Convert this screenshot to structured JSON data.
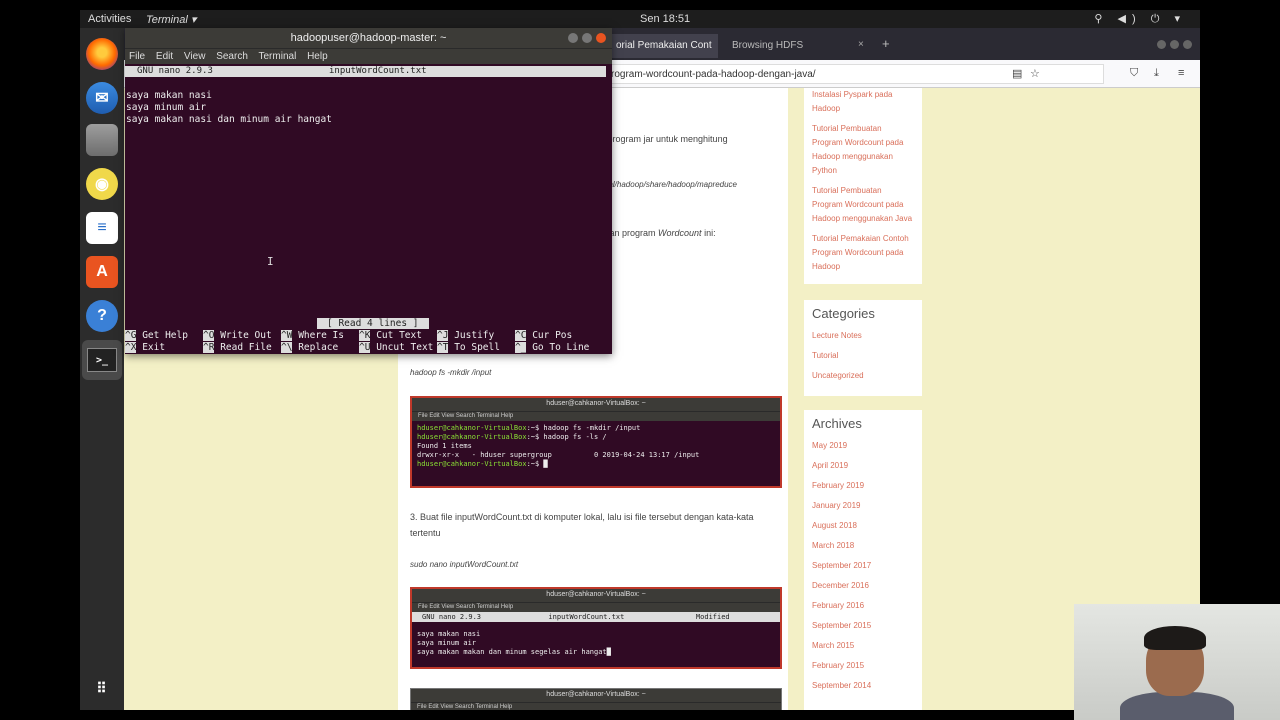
{
  "topbar": {
    "activities": "Activities",
    "app_menu": "Terminal ▾",
    "clock": "Sen 18:51",
    "tray": "⚲ ◀) ⏻ ▾"
  },
  "dock": {
    "items": [
      "firefox-icon",
      "thunderbird-icon",
      "files-icon",
      "rhythmbox-icon",
      "writer-icon",
      "software-icon",
      "help-icon",
      "terminal-icon"
    ],
    "help_glyph": "?",
    "terminal_glyph": ">_"
  },
  "browser": {
    "tab_active": "orial Pemakaian Cont",
    "tab_close": "×",
    "tab2": "Browsing HDFS",
    "new_tab": "+",
    "url": "rogram-wordcount-pada-hadoop-dengan-java/",
    "icons": {
      "reader": "▤",
      "star": "☆",
      "pocket": "⛉",
      "download": "⤓",
      "menu": "≡"
    }
  },
  "content": {
    "line1": "n program jar untuk menghitung",
    "line2": "ocal/hadoop/share/hadoop/mapreduce",
    "line3_prefix": "akan program ",
    "line3_em": "Wordcount",
    "line3_suffix": " ini:",
    "cmd_mkdir": "hadoop fs -mkdir /input",
    "step3": "3. Buat file inputWordCount.txt di komputer lokal, lalu isi file tersebut dengan kata-kata",
    "step3b": "tertentu",
    "cmd_nano": "sudo nano inputWordCount.txt",
    "shot1": {
      "title": "hduser@cahkanor-VirtualBox: ~",
      "menu": "File  Edit  View  Search  Terminal  Help",
      "l1a": "hduser@cahkanor-VirtualBox",
      "l1b": ":~$ hadoop fs -mkdir /input",
      "l2a": "hduser@cahkanor-VirtualBox",
      "l2b": ":~$ hadoop fs -ls /",
      "l3": "Found 1 items",
      "l4": "drwxr-xr-x   - hduser supergroup          0 2019-04-24 13:17 /input",
      "l5a": "hduser@cahkanor-VirtualBox",
      "l5b": ":~$ █"
    },
    "shot2": {
      "title": "hduser@cahkanor-VirtualBox: ~",
      "menu": "File  Edit  View  Search  Terminal  Help",
      "head": "GNU nano 2.9.3                inputWordCount.txt                 Modified",
      "l1": "saya makan nasi",
      "l2": "saya minum air",
      "l3": "saya makan makan dan minum segelas air hangat█"
    },
    "shot3": {
      "title": "hduser@cahkanor-VirtualBox: ~",
      "menu": "File  Edit  View  Search  Terminal  Help"
    }
  },
  "sidebar": {
    "recent_top": "Instalasi Pyspark pada",
    "recent0": "Hadoop",
    "recent": [
      "Tutorial Pembuatan Program Wordcount pada Hadoop menggunakan Python",
      "Tutorial Pembuatan Program Wordcount pada Hadoop menggunakan Java",
      "Tutorial Pemakaian Contoh Program Wordcount pada Hadoop"
    ],
    "categories_title": "Categories",
    "categories": [
      "Lecture Notes",
      "Tutorial",
      "Uncategorized"
    ],
    "archives_title": "Archives",
    "archives": [
      "May 2019",
      "April 2019",
      "February 2019",
      "January 2019",
      "August 2018",
      "March 2018",
      "September 2017",
      "December 2016",
      "February 2016",
      "September 2015",
      "March 2015",
      "February 2015",
      "September 2014"
    ]
  },
  "terminal": {
    "title": "hadoopuser@hadoop-master: ~",
    "menu": [
      "File",
      "Edit",
      "View",
      "Search",
      "Terminal",
      "Help"
    ],
    "nano_version": "GNU nano 2.9.3",
    "filename": "inputWordCount.txt",
    "lines": [
      "saya makan nasi",
      "saya minum air",
      "saya makan nasi dan minum air hangat"
    ],
    "status": "[ Read 4 lines ]",
    "shortcuts": [
      {
        "key": "^G",
        "label": "Get Help"
      },
      {
        "key": "^O",
        "label": "Write Out"
      },
      {
        "key": "^W",
        "label": "Where Is"
      },
      {
        "key": "^K",
        "label": "Cut Text"
      },
      {
        "key": "^J",
        "label": "Justify"
      },
      {
        "key": "^C",
        "label": "Cur Pos"
      },
      {
        "key": "^X",
        "label": "Exit"
      },
      {
        "key": "^R",
        "label": "Read File"
      },
      {
        "key": "^\\",
        "label": "Replace"
      },
      {
        "key": "^U",
        "label": "Uncut Text"
      },
      {
        "key": "^T",
        "label": "To Spell"
      },
      {
        "key": "^_",
        "label": "Go To Line"
      }
    ],
    "text_cursor": "I"
  },
  "colors": {
    "terminal_bg": "#300a24",
    "ubuntu_orange": "#e95420",
    "link": "#d96f5a",
    "page_bg": "#f3f0c6"
  }
}
